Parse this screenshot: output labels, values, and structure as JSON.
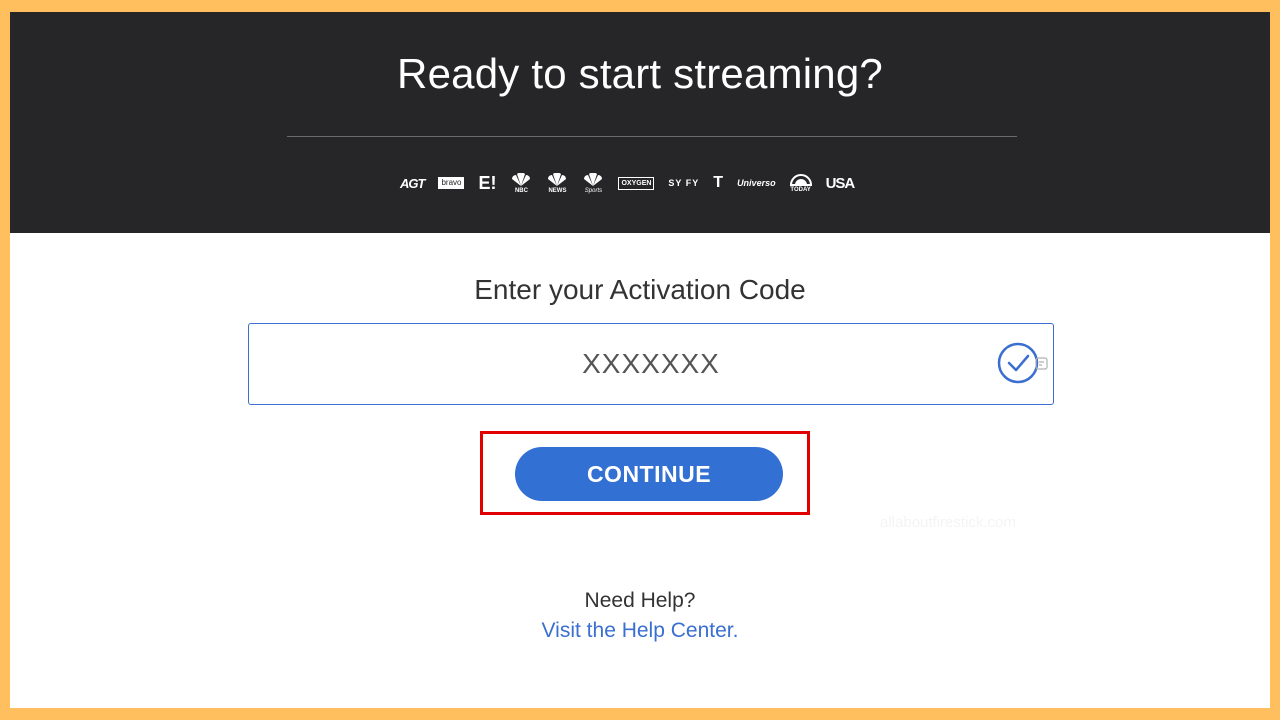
{
  "hero": {
    "title": "Ready to start streaming?",
    "networks": [
      {
        "name": "AGT",
        "label": "AGT"
      },
      {
        "name": "bravo",
        "label": "bravo"
      },
      {
        "name": "E!",
        "label": "E!"
      },
      {
        "name": "NBC",
        "label": "NBC"
      },
      {
        "name": "NBC News",
        "label": "NEWS"
      },
      {
        "name": "NBC Sports",
        "label": "Sports"
      },
      {
        "name": "Oxygen",
        "label": "OXYGEN"
      },
      {
        "name": "SYFY",
        "label": "SY FY"
      },
      {
        "name": "Telemundo",
        "label": "T"
      },
      {
        "name": "Universo",
        "label": "Universo"
      },
      {
        "name": "Today",
        "label": "TODAY"
      },
      {
        "name": "USA",
        "label": "USA"
      }
    ]
  },
  "activation": {
    "label": "Enter your Activation Code",
    "placeholder": "XXXXXXX",
    "value": ""
  },
  "continue": {
    "label": "CONTINUE"
  },
  "watermark": "allaboutfirestick.com",
  "help": {
    "prompt": "Need Help?",
    "link_text": "Visit the Help Center."
  },
  "colors": {
    "frame_border": "#ffbf5f",
    "hero_background": "#262628",
    "accent": "#3370d4",
    "highlight": "#e00000"
  }
}
